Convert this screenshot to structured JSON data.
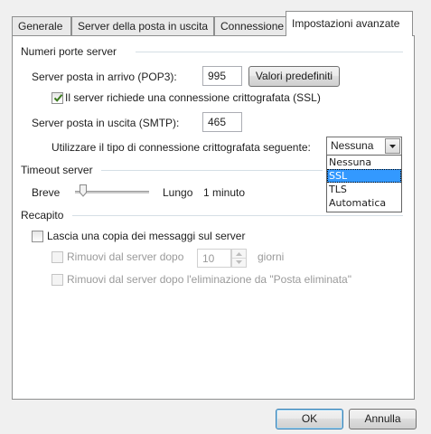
{
  "tabs": [
    {
      "label": "Generale"
    },
    {
      "label": "Server della posta in uscita"
    },
    {
      "label": "Connessione"
    },
    {
      "label": "Impostazioni avanzate"
    }
  ],
  "ports": {
    "group_title": "Numeri porte server",
    "incoming_label": "Server posta in arrivo (POP3):",
    "incoming_value": "995",
    "defaults_button": "Valori predefiniti",
    "ssl_required_label": "Il server richiede una connessione crittografata (SSL)",
    "ssl_required_checked": true,
    "outgoing_label": "Server posta in uscita (SMTP):",
    "outgoing_value": "465",
    "encryption_label": "Utilizzare il tipo di connessione crittografata seguente:",
    "encryption_value": "Nessuna",
    "encryption_options": [
      "Nessuna",
      "SSL",
      "TLS",
      "Automatica"
    ],
    "highlighted_option": "SSL"
  },
  "timeout": {
    "group_title": "Timeout server",
    "short_label": "Breve",
    "long_label": "Lungo",
    "value_text": "1 minuto"
  },
  "delivery": {
    "group_title": "Recapito",
    "leave_copy_label": "Lascia una copia dei messaggi sul server",
    "leave_copy_checked": false,
    "remove_after_label": "Rimuovi dal server dopo",
    "remove_after_value": "10",
    "days_label": "giorni",
    "remove_deleted_label": "Rimuovi dal server dopo l'eliminazione da \"Posta eliminata\""
  },
  "footer": {
    "ok_label": "OK",
    "cancel_label": "Annulla"
  },
  "colors": {
    "selection": "#3399ff",
    "panel": "#ffffff",
    "dialog": "#f0f0f0"
  }
}
